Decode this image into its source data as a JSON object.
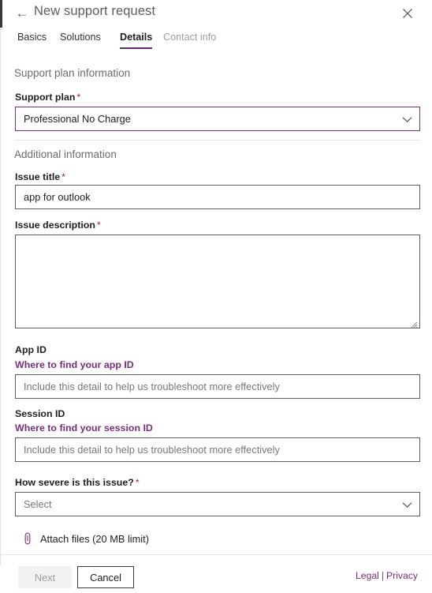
{
  "header": {
    "title": "New support request",
    "back_icon": "back-arrow-icon",
    "close_icon": "close-icon"
  },
  "tabs": [
    {
      "label": "Basics",
      "state": "normal"
    },
    {
      "label": "Solutions",
      "state": "normal"
    },
    {
      "label": "Details",
      "state": "active"
    },
    {
      "label": "Contact info",
      "state": "disabled"
    }
  ],
  "sections": {
    "support_plan_heading": "Support plan information",
    "additional_heading": "Additional information"
  },
  "fields": {
    "support_plan": {
      "label": "Support plan",
      "required": "*",
      "value": "Professional No Charge",
      "chevron": "chevron-down-icon"
    },
    "issue_title": {
      "label": "Issue title",
      "required": "*",
      "value": "app for outlook"
    },
    "issue_description": {
      "label": "Issue description",
      "required": "*",
      "value": ""
    },
    "app_id": {
      "label": "App ID",
      "help_link": "Where to find your app ID",
      "placeholder": "Include this detail to help us troubleshoot more effectively",
      "value": ""
    },
    "session_id": {
      "label": "Session ID",
      "help_link": "Where to find your session ID",
      "placeholder": "Include this detail to help us troubleshoot more effectively",
      "value": ""
    },
    "severity": {
      "label": "How severe is this issue?",
      "required": "*",
      "value": "Select",
      "chevron": "chevron-down-icon"
    }
  },
  "attach": {
    "label": "Attach files (20 MB limit)",
    "icon": "paperclip-icon"
  },
  "footer": {
    "next_label": "Next",
    "cancel_label": "Cancel",
    "legal_label": "Legal",
    "separator": "|",
    "privacy_label": "Privacy"
  },
  "colors": {
    "accent_purple": "#7a2d7e",
    "tab_underline": "#5c2d60",
    "required_red": "#a4262c",
    "border_dark": "#605e5c",
    "disabled_bg": "#f3f2f1"
  }
}
